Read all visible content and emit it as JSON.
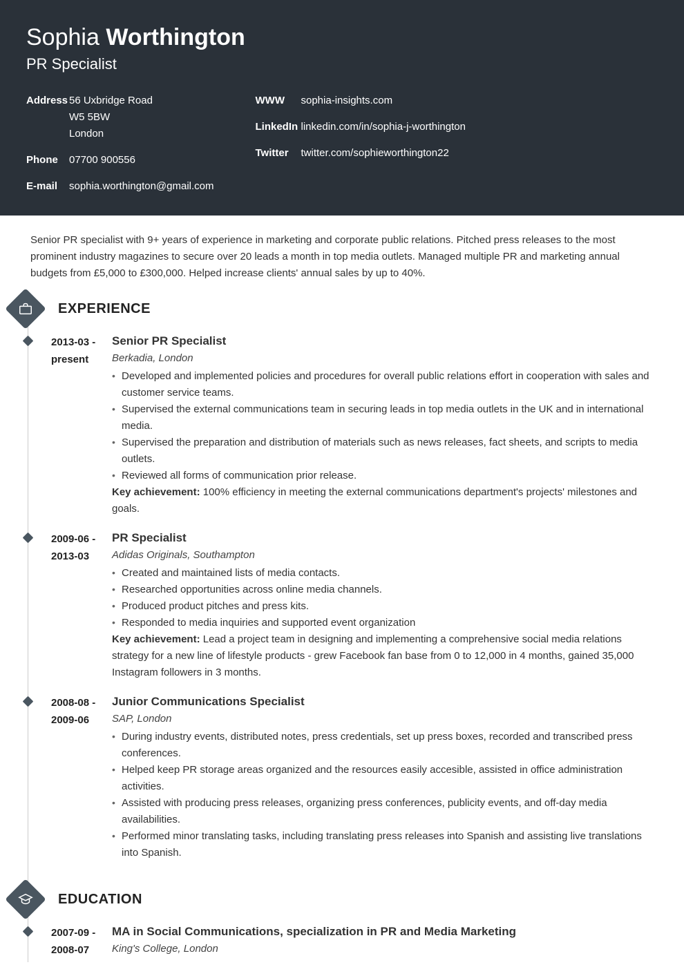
{
  "header": {
    "firstname": "Sophia",
    "lastname": "Worthington",
    "role": "PR Specialist",
    "contacts_left": [
      {
        "label": "Address",
        "value": "56 Uxbridge Road\nW5 5BW\nLondon"
      },
      {
        "label": "Phone",
        "value": "07700 900556"
      },
      {
        "label": "E-mail",
        "value": "sophia.worthington@gmail.com"
      }
    ],
    "contacts_right": [
      {
        "label": "WWW",
        "value": "sophia-insights.com"
      },
      {
        "label": "LinkedIn",
        "value": "linkedin.com/in/sophia-j-worthington"
      },
      {
        "label": "Twitter",
        "value": "twitter.com/sophieworthington22"
      }
    ]
  },
  "summary": "Senior PR specialist with 9+ years of experience in marketing and corporate public relations. Pitched press releases to the most prominent industry magazines to secure over 20 leads a month in top media outlets. Managed multiple PR and marketing annual budgets from £5,000 to £300,000. Helped increase clients' annual sales by up to 40%.",
  "sections": {
    "experience_title": "EXPERIENCE",
    "education_title": "EDUCATION"
  },
  "experience": [
    {
      "dates": "2013-03 - present",
      "title": "Senior PR Specialist",
      "company": "Berkadia, London",
      "bullets": [
        "Developed and implemented policies and procedures for overall public relations effort in cooperation with sales and customer service teams.",
        "Supervised the external communications team in securing leads in top media outlets in the UK and in international media.",
        "Supervised the preparation and distribution of materials such as news releases, fact sheets, and scripts to media outlets.",
        "Reviewed all forms of communication prior release."
      ],
      "key_label": "Key achievement:",
      "key_text": " 100% efficiency in meeting the external communications department's projects' milestones and goals."
    },
    {
      "dates": "2009-06 - 2013-03",
      "title": "PR Specialist",
      "company": "Adidas Originals, Southampton",
      "bullets": [
        "Created and maintained lists of media contacts.",
        "Researched opportunities across online media channels.",
        "Produced product pitches and press kits.",
        "Responded to media inquiries and supported event organization"
      ],
      "key_label": "Key achievement:",
      "key_text": " Lead a project team in designing and implementing a comprehensive social media relations strategy for a new line of lifestyle products - grew Facebook fan base from 0 to 12,000 in 4 months, gained 35,000 Instagram followers in 3 months."
    },
    {
      "dates": "2008-08 - 2009-06",
      "title": "Junior Communications Specialist",
      "company": "SAP, London",
      "bullets": [
        "During industry events, distributed notes, press credentials, set up press boxes, recorded and transcribed press conferences.",
        "Helped keep PR storage areas organized and the resources easily accesible, assisted in office administration activities.",
        "Assisted with producing press releases, organizing press conferences, publicity events, and off-day media availabilities.",
        "Performed minor translating tasks, including translating press releases into Spanish and assisting live translations into Spanish."
      ],
      "key_label": "",
      "key_text": ""
    }
  ],
  "education": [
    {
      "dates": "2007-09 - 2008-07",
      "title": "MA in Social Communications, specialization in PR and Media Marketing",
      "company": "King's College, London"
    }
  ]
}
